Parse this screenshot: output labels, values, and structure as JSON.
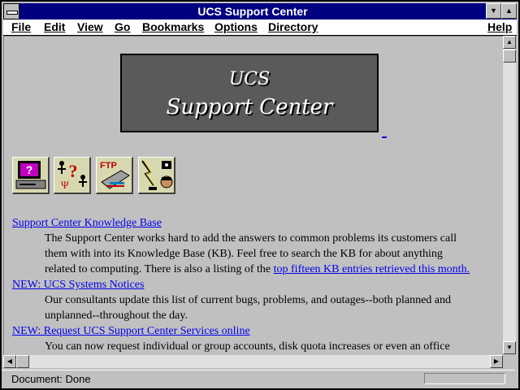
{
  "window": {
    "title": "UCS Support Center"
  },
  "menu": [
    "File",
    "Edit",
    "View",
    "Go",
    "Bookmarks",
    "Options",
    "Directory",
    "Help"
  ],
  "banner": {
    "line1": "UCS",
    "line2": "Support Center"
  },
  "icons": [
    "help-computer-icon",
    "help-people-icon",
    "ftp-icon",
    "phone-icon"
  ],
  "icon_labels": {
    "ftp": "FTP"
  },
  "sections": [
    {
      "link": "Support Center Knowledge Base ",
      "text1": "The Support Center works hard to add the answers to common problems its customers call",
      "text2": "them with into its Knowledge Base (KB). Feel free to search the KB for about anything",
      "text3": "related to computing. There is also a listing of the ",
      "inline_link": "top fifteen KB entries retrieved this month."
    },
    {
      "link": "NEW: UCS Systems Notices",
      "text1": "Our consultants update this list of current bugs, problems, and outages--both planned and",
      "text2": "unplanned--throughout the day."
    },
    {
      "link": "NEW: Request UCS Support Center Services online",
      "text1": "You can now request individual or group accounts, disk quota increases or even an office"
    }
  ],
  "status": {
    "text": "Document: Done"
  }
}
